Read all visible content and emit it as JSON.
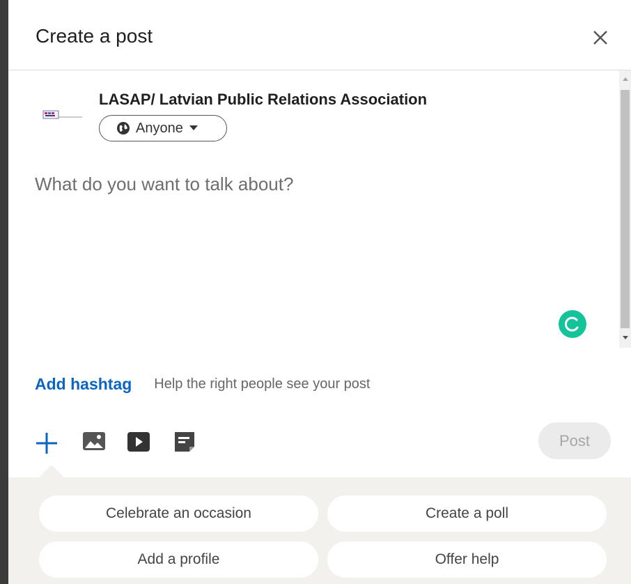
{
  "dialog": {
    "title": "Create a post"
  },
  "author": {
    "name": "LASAP/ Latvian Public Relations Association",
    "visibility": "Anyone"
  },
  "composer": {
    "placeholder": "What do you want to talk about?"
  },
  "hashtag": {
    "add_label": "Add hashtag",
    "help_text": "Help the right people see your post"
  },
  "toolbar": {
    "post_label": "Post",
    "icons": [
      "plus-icon",
      "photo-icon",
      "video-icon",
      "document-icon"
    ]
  },
  "suggestions": [
    {
      "label": "Celebrate an occasion"
    },
    {
      "label": "Create a poll"
    },
    {
      "label": "Add a profile"
    },
    {
      "label": "Offer help"
    }
  ],
  "colors": {
    "accent": "#0a66c2",
    "grammarly": "#15c39a",
    "post_disabled_bg": "#ebebeb"
  }
}
